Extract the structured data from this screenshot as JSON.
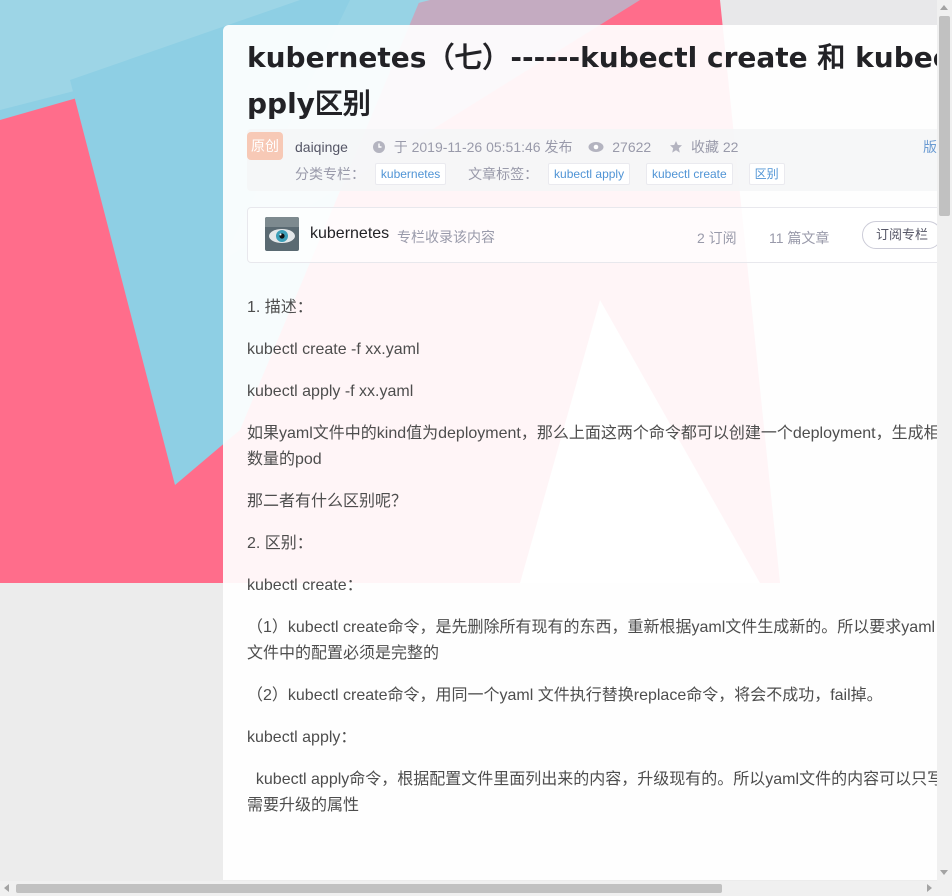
{
  "article": {
    "title": "kubernetes（七）------kubectl create 和 kubectl apply区别",
    "badge": "原创",
    "author": "daiqinge",
    "published": "于 2019-11-26 05:51:46 发布",
    "views": "27622",
    "favorites": "收藏 22",
    "edit_link": "版",
    "category_label": "分类专栏：",
    "categories": [
      "kubernetes"
    ],
    "tags_label": "文章标签：",
    "tags": [
      "kubectl apply",
      "kubectl create",
      "区别"
    ]
  },
  "column": {
    "name": "kubernetes",
    "desc": "专栏收录该内容",
    "subscribers": "2 订阅",
    "articles": "11 篇文章",
    "subscribe_label": "订阅专栏"
  },
  "content": [
    "1. 描述：",
    "kubectl create -f xx.yaml",
    "kubectl apply -f xx.yaml",
    "如果yaml文件中的kind值为deployment，那么上面这两个命令都可以创建一个deployment，生成相应数量的pod",
    "那二者有什么区别呢？",
    "2. 区别：",
    "kubectl create：",
    "（1）kubectl create命令，是先删除所有现有的东西，重新根据yaml文件生成新的。所以要求yaml文件中的配置必须是完整的",
    "（2）kubectl create命令，用同一个yaml 文件执行替换replace命令，将会不成功，fail掉。",
    "kubectl apply：",
    "  kubectl apply命令，根据配置文件里面列出来的内容，升级现有的。所以yaml文件的内容可以只写需要升级的属性"
  ],
  "icons": {
    "clock": "clock-icon",
    "eye": "eye-icon",
    "star": "star-icon"
  },
  "colors": {
    "bg_pink": "#ff6d8b",
    "bg_blue": "#8ecfe4",
    "tag_blue": "#5094d5",
    "badge": "#f7c9b6"
  }
}
